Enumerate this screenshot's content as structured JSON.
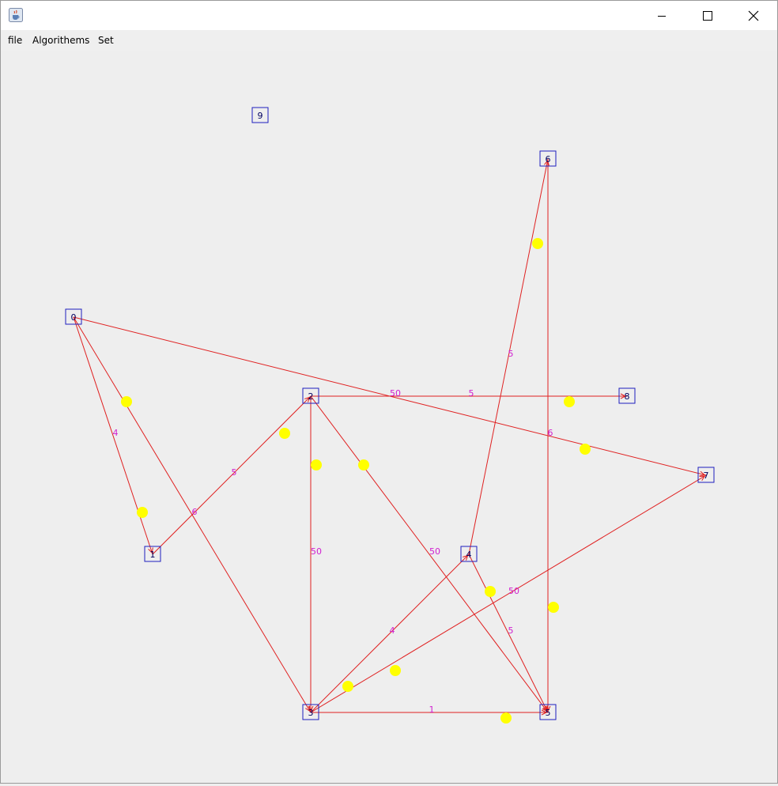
{
  "window": {
    "icon": "java-cup-icon",
    "controls": [
      "minimize-icon",
      "maximize-icon",
      "close-icon"
    ]
  },
  "menu": {
    "items": [
      "file",
      "Algorithems",
      "Set"
    ]
  },
  "graph": {
    "colors": {
      "node_border": "#1f1fbf",
      "node_fill": "#eeeeee",
      "node_text": "#000060",
      "edge": "#e02020",
      "weight_label": "#d020d0",
      "marker": "#ffff00"
    },
    "nodes": [
      {
        "id": "0",
        "label": "0"
      },
      {
        "id": "1",
        "label": "1"
      },
      {
        "id": "2",
        "label": "2"
      },
      {
        "id": "3",
        "label": "3"
      },
      {
        "id": "4",
        "label": "4"
      },
      {
        "id": "5",
        "label": "5"
      },
      {
        "id": "6",
        "label": "6"
      },
      {
        "id": "7",
        "label": "7"
      },
      {
        "id": "8",
        "label": "8"
      },
      {
        "id": "9",
        "label": "9"
      }
    ],
    "edges": [
      {
        "from": "0",
        "to": "1",
        "weight": "4"
      },
      {
        "from": "0",
        "to": "3",
        "weight": "6"
      },
      {
        "from": "0",
        "to": "7",
        "weight": "6"
      },
      {
        "from": "1",
        "to": "2",
        "weight": "5"
      },
      {
        "from": "2",
        "to": "8",
        "weight": "5"
      },
      {
        "from": "2",
        "to": "3",
        "weight": "50"
      },
      {
        "from": "2",
        "to": "5",
        "weight": "50"
      },
      {
        "from": "3",
        "to": "5",
        "weight": "1"
      },
      {
        "from": "3",
        "to": "4",
        "weight": "4"
      },
      {
        "from": "3",
        "to": "7",
        "weight": "50"
      },
      {
        "from": "4",
        "to": "5",
        "weight": "5"
      },
      {
        "from": "4",
        "to": "6",
        "weight": "5"
      },
      {
        "from": "6",
        "to": "5",
        "weight": ""
      }
    ],
    "extra_labels": [
      "50"
    ]
  }
}
